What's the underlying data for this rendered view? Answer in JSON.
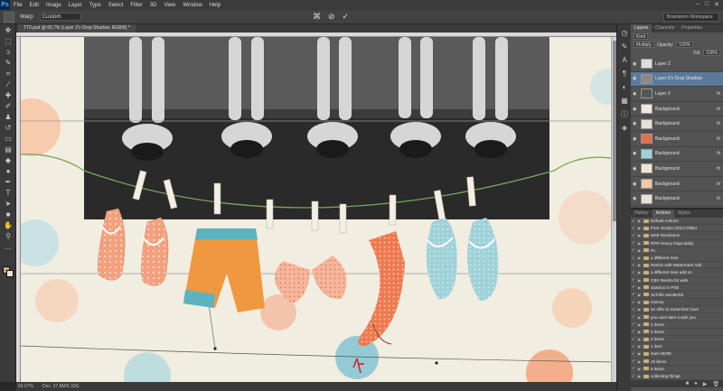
{
  "app": {
    "logo": "Ps"
  },
  "menu": [
    "File",
    "Edit",
    "Image",
    "Layer",
    "Type",
    "Select",
    "Filter",
    "3D",
    "View",
    "Window",
    "Help"
  ],
  "window_controls": [
    "–",
    "□",
    "✕"
  ],
  "options_bar": {
    "warp_label": "Warp:",
    "warp_value": "Custom",
    "workspace": "Brainstorm Workspace"
  },
  "document": {
    "tab_title": "TT0.psd @ 66.7% (Layer 2's Drop Shadow, RGB/8) *",
    "zoom": "66.67%",
    "doc_info": "Doc: 37.8M/5.33G",
    "hand_cursor": "↖"
  },
  "layers_panel": {
    "tabs": [
      "Layers",
      "Channels",
      "Properties"
    ],
    "blend_mode": "Multiply",
    "opacity_label": "Opacity:",
    "opacity": "100%",
    "fill_label": "Fill:",
    "fill": "100%",
    "layers": [
      {
        "name": "Layer 2",
        "fx": "",
        "selected": false,
        "thumb": "#dcdcdc"
      },
      {
        "name": "Layer 2's Drop Shadow",
        "fx": "",
        "selected": true,
        "thumb": "#8a8a8a"
      },
      {
        "name": "Layer 3",
        "fx": "fx",
        "selected": false,
        "thumb": "#555555"
      },
      {
        "name": "Background",
        "fx": "fx",
        "selected": false,
        "thumb": "#efe9dc"
      },
      {
        "name": "Background",
        "fx": "fx",
        "selected": false,
        "thumb": "#e6e1d5"
      },
      {
        "name": "Background",
        "fx": "fx",
        "selected": false,
        "thumb": "#e86c4a"
      },
      {
        "name": "Background",
        "fx": "fx",
        "selected": false,
        "thumb": "#9fd2d8"
      },
      {
        "name": "Background",
        "fx": "fx",
        "selected": false,
        "thumb": "#f0e6d6"
      },
      {
        "name": "Background",
        "fx": "fx",
        "selected": false,
        "thumb": "#f2c7a1"
      },
      {
        "name": "Background",
        "fx": "fx",
        "selected": false,
        "thumb": "#e9e2d4"
      }
    ]
  },
  "actions_panel": {
    "tabs": [
      "History",
      "Actions",
      "Styles"
    ],
    "items": [
      "Default Actions",
      "Free Scripts (2013 Glitter",
      "Web Resolution",
      "RPR Heavy Days Baby",
      "PL",
      "a different tone",
      "Resize with Watermark Add",
      "a different tone add on",
      "CBS Resize for web",
      "classics in PSE",
      "Ja'll life wonderful",
      "Harvey",
      "an offer to remember (ove",
      "you can't take it with you",
      "4 items",
      "3 items",
      "2 items",
      "1 item",
      "start HERE",
      "10 items",
      "9 items",
      "collecting things"
    ]
  }
}
